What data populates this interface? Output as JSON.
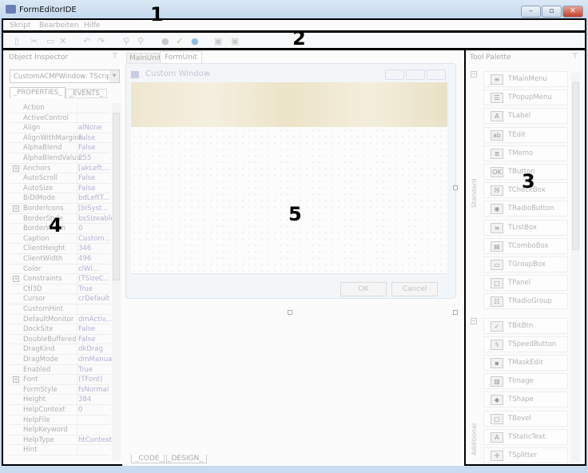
{
  "window": {
    "title": "FormEditorIDE",
    "controls": [
      "–",
      "▫",
      "✕"
    ]
  },
  "menu": [
    "Skript",
    "Bearbeiten",
    "Hilfe"
  ],
  "toolbar": [
    "copy-icon",
    "cut-icon",
    "paste-icon",
    "delete-icon",
    "undo-icon",
    "redo-icon",
    "find-icon",
    "replace-icon",
    "stop-icon",
    "check-icon",
    "run-icon",
    "lock-icon",
    "unlock-icon"
  ],
  "annotations": [
    "1",
    "2",
    "3",
    "4",
    "5"
  ],
  "inspector": {
    "title": "Object Inspector",
    "object": "CustomACMPWindow: TScriptF",
    "tabs": [
      "_PROPERTIES_",
      "_EVENTS_"
    ],
    "rows": [
      {
        "n": "Action",
        "v": ""
      },
      {
        "n": "ActiveControl",
        "v": ""
      },
      {
        "n": "Align",
        "v": "alNone"
      },
      {
        "n": "AlignWithMargins",
        "v": "False"
      },
      {
        "n": "AlphaBlend",
        "v": "False"
      },
      {
        "n": "AlphaBlendValue",
        "v": "255"
      },
      {
        "n": "Anchors",
        "v": "[akLeft,...",
        "e": true
      },
      {
        "n": "AutoScroll",
        "v": "False"
      },
      {
        "n": "AutoSize",
        "v": "False"
      },
      {
        "n": "BiDiMode",
        "v": "bdLeftT..."
      },
      {
        "n": "BorderIcons",
        "v": "[biSyst...",
        "e": true
      },
      {
        "n": "BorderStyle",
        "v": "bsSizeable"
      },
      {
        "n": "BorderWidth",
        "v": "0"
      },
      {
        "n": "Caption",
        "v": "Custom..."
      },
      {
        "n": "ClientHeight",
        "v": "346"
      },
      {
        "n": "ClientWidth",
        "v": "496"
      },
      {
        "n": "Color",
        "v": "clWi..."
      },
      {
        "n": "Constraints",
        "v": "(TSizeC...",
        "e": true
      },
      {
        "n": "Ctl3D",
        "v": "True"
      },
      {
        "n": "Cursor",
        "v": "crDefault"
      },
      {
        "n": "CustomHint",
        "v": ""
      },
      {
        "n": "DefaultMonitor",
        "v": "dmActiv..."
      },
      {
        "n": "DockSite",
        "v": "False"
      },
      {
        "n": "DoubleBuffered",
        "v": "False"
      },
      {
        "n": "DragKind",
        "v": "dkDrag"
      },
      {
        "n": "DragMode",
        "v": "dmManual"
      },
      {
        "n": "Enabled",
        "v": "True"
      },
      {
        "n": "Font",
        "v": "(TFont)",
        "e": true
      },
      {
        "n": "FormStyle",
        "v": "fsNormal"
      },
      {
        "n": "Height",
        "v": "384"
      },
      {
        "n": "HelpContext",
        "v": "0"
      },
      {
        "n": "HelpFile",
        "v": ""
      },
      {
        "n": "HelpKeyword",
        "v": ""
      },
      {
        "n": "HelpType",
        "v": "htContext"
      },
      {
        "n": "Hint",
        "v": ""
      }
    ]
  },
  "editor": {
    "tabs": [
      "MainUnit",
      "FormUnit"
    ],
    "active_tab": "FormUnit",
    "bottom_tabs": [
      "_CODE_",
      "_DESIGN_"
    ],
    "form": {
      "title": "Custom Window",
      "ok": "OK",
      "cancel": "Cancel"
    }
  },
  "palette": {
    "title": "Tool Palette",
    "categories": [
      {
        "name": "Standard",
        "items": [
          {
            "l": "TMainMenu",
            "i": "≡"
          },
          {
            "l": "TPopupMenu",
            "i": "☰"
          },
          {
            "l": "TLabel",
            "i": "A"
          },
          {
            "l": "TEdit",
            "i": "ab"
          },
          {
            "l": "TMemo",
            "i": "≣"
          },
          {
            "l": "TButton",
            "i": "OK"
          },
          {
            "l": "TCheckBox",
            "i": "☒"
          },
          {
            "l": "TRadioButton",
            "i": "◉"
          },
          {
            "l": "TListBox",
            "i": "≡"
          },
          {
            "l": "TComboBox",
            "i": "▤"
          },
          {
            "l": "TGroupBox",
            "i": "▭"
          },
          {
            "l": "TPanel",
            "i": "□"
          },
          {
            "l": "TRadioGroup",
            "i": "☷"
          }
        ]
      },
      {
        "name": "Additional",
        "items": [
          {
            "l": "TBitBtn",
            "i": "✓"
          },
          {
            "l": "TSpeedButton",
            "i": "ϟ"
          },
          {
            "l": "TMaskEdit",
            "i": "▪"
          },
          {
            "l": "TImage",
            "i": "▨"
          },
          {
            "l": "TShape",
            "i": "◆"
          },
          {
            "l": "TBevel",
            "i": "▢"
          },
          {
            "l": "TStaticText",
            "i": "A"
          },
          {
            "l": "TSplitter",
            "i": "✛"
          }
        ]
      }
    ]
  }
}
